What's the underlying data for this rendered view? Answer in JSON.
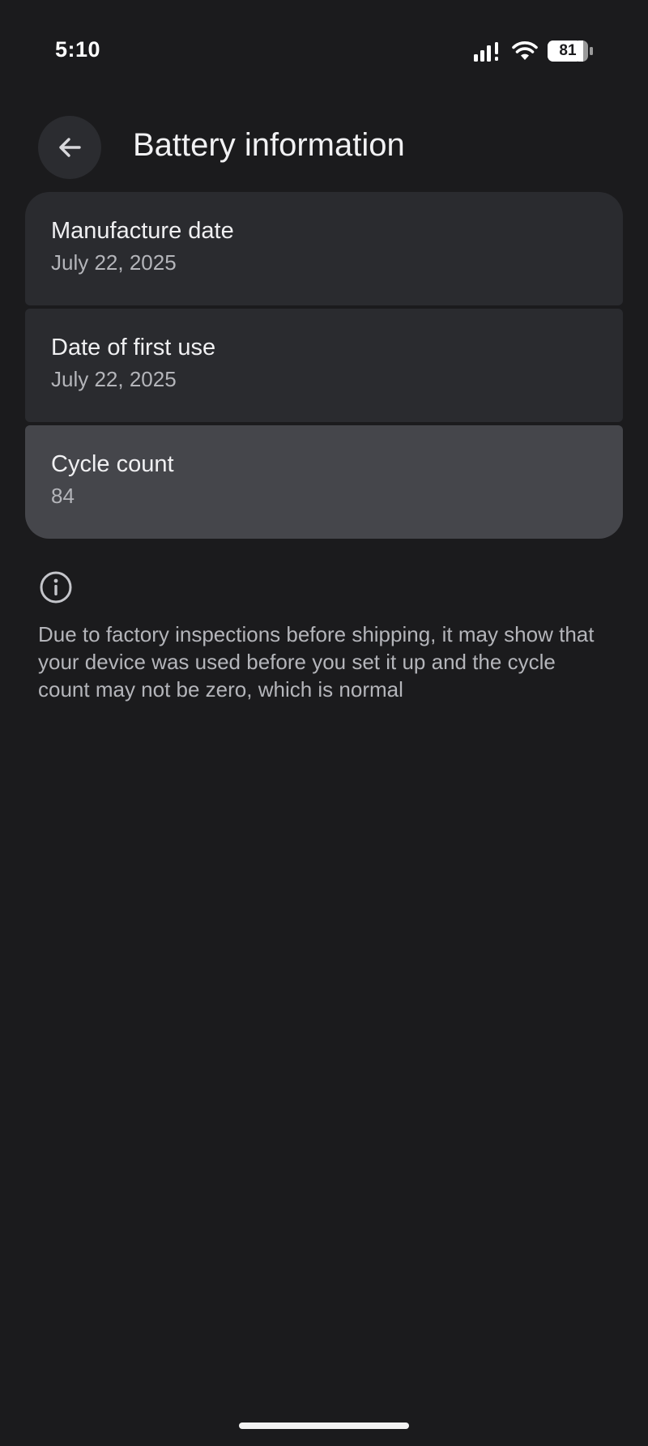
{
  "status_bar": {
    "time": "5:10",
    "battery_level": "81"
  },
  "header": {
    "title": "Battery information",
    "back_icon": "arrow-left-icon"
  },
  "cards": [
    {
      "title": "Manufacture date",
      "value": "July 22, 2025"
    },
    {
      "title": "Date of first use",
      "value": "July 22, 2025"
    },
    {
      "title": "Cycle count",
      "value": "84"
    }
  ],
  "info": {
    "icon": "info-icon",
    "text": "Due to factory inspections before shipping, it may show that your device was used before you set it up and the cycle count may not be zero, which is normal"
  },
  "colors": {
    "background": "#1b1b1d",
    "card": "#2a2b2f",
    "card_selected": "#45464b",
    "text_primary": "#f0f0f2",
    "text_secondary": "#b4b5ba"
  }
}
